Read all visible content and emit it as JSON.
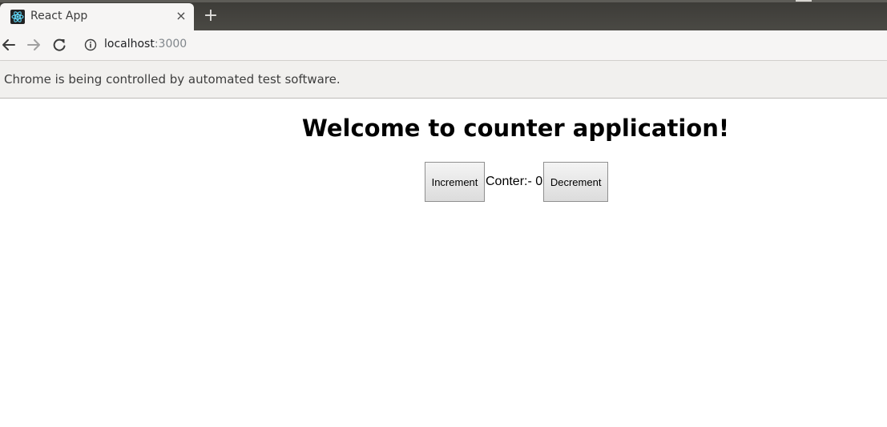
{
  "browser": {
    "tab": {
      "title": "React App",
      "close_symbol": "×",
      "favicon_icon": "react-logo-icon"
    },
    "new_tab_symbol": "+",
    "toolbar": {
      "back_icon": "arrow-left-icon",
      "forward_icon": "arrow-right-icon",
      "reload_icon": "reload-icon",
      "info_icon": "info-icon",
      "url_host": "localhost",
      "url_port": ":3000"
    },
    "infobar": {
      "text": "Chrome is being controlled by automated test software."
    },
    "colors": {
      "tabstrip": "#3c3b37",
      "toolbar": "#f6f5f4",
      "infobar": "#f1f0ee"
    }
  },
  "page": {
    "heading": "Welcome to counter application!",
    "increment_label": "Increment",
    "counter_label": "Conter:- ",
    "counter_value": "0",
    "decrement_label": "Decrement"
  }
}
